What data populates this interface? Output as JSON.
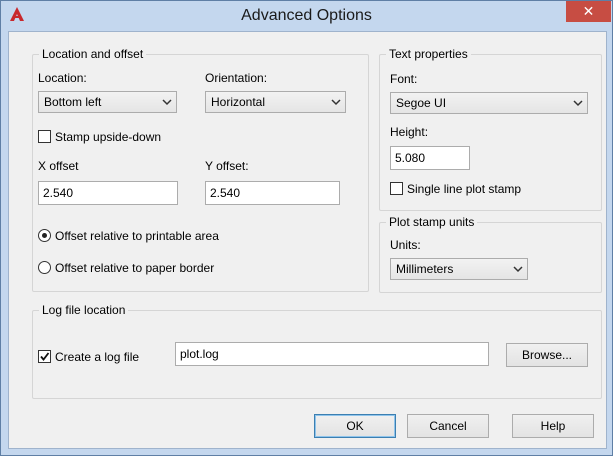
{
  "window": {
    "title": "Advanced Options",
    "close_glyph": "✕"
  },
  "location_group": {
    "title": "Location and offset",
    "location_label": "Location:",
    "location_value": "Bottom left",
    "orientation_label": "Orientation:",
    "orientation_value": "Horizontal",
    "stamp_upside_down": {
      "label": "Stamp upside-down",
      "checked": false
    },
    "x_offset_label": "X offset",
    "x_offset_value": "2.540",
    "y_offset_label": "Y offset:",
    "y_offset_value": "2.540",
    "radio_printable": {
      "label": "Offset relative to printable area",
      "selected": true
    },
    "radio_paper": {
      "label": "Offset relative to paper border",
      "selected": false
    }
  },
  "text_group": {
    "title": "Text properties",
    "font_label": "Font:",
    "font_value": "Segoe UI",
    "height_label": "Height:",
    "height_value": "5.080",
    "single_line": {
      "label": "Single line plot stamp",
      "checked": false
    }
  },
  "units_group": {
    "title": "Plot stamp units",
    "units_label": "Units:",
    "units_value": "Millimeters"
  },
  "log_group": {
    "title": "Log file location",
    "create_log": {
      "label": "Create a log file",
      "checked": true
    },
    "file_value": "plot.log",
    "browse_label": "Browse..."
  },
  "footer": {
    "ok_label": "OK",
    "cancel_label": "Cancel",
    "help_label": "Help"
  },
  "colors": {
    "accent": "#3c7fb1",
    "close_red": "#c74d43",
    "frame": "#c4d7ee"
  }
}
